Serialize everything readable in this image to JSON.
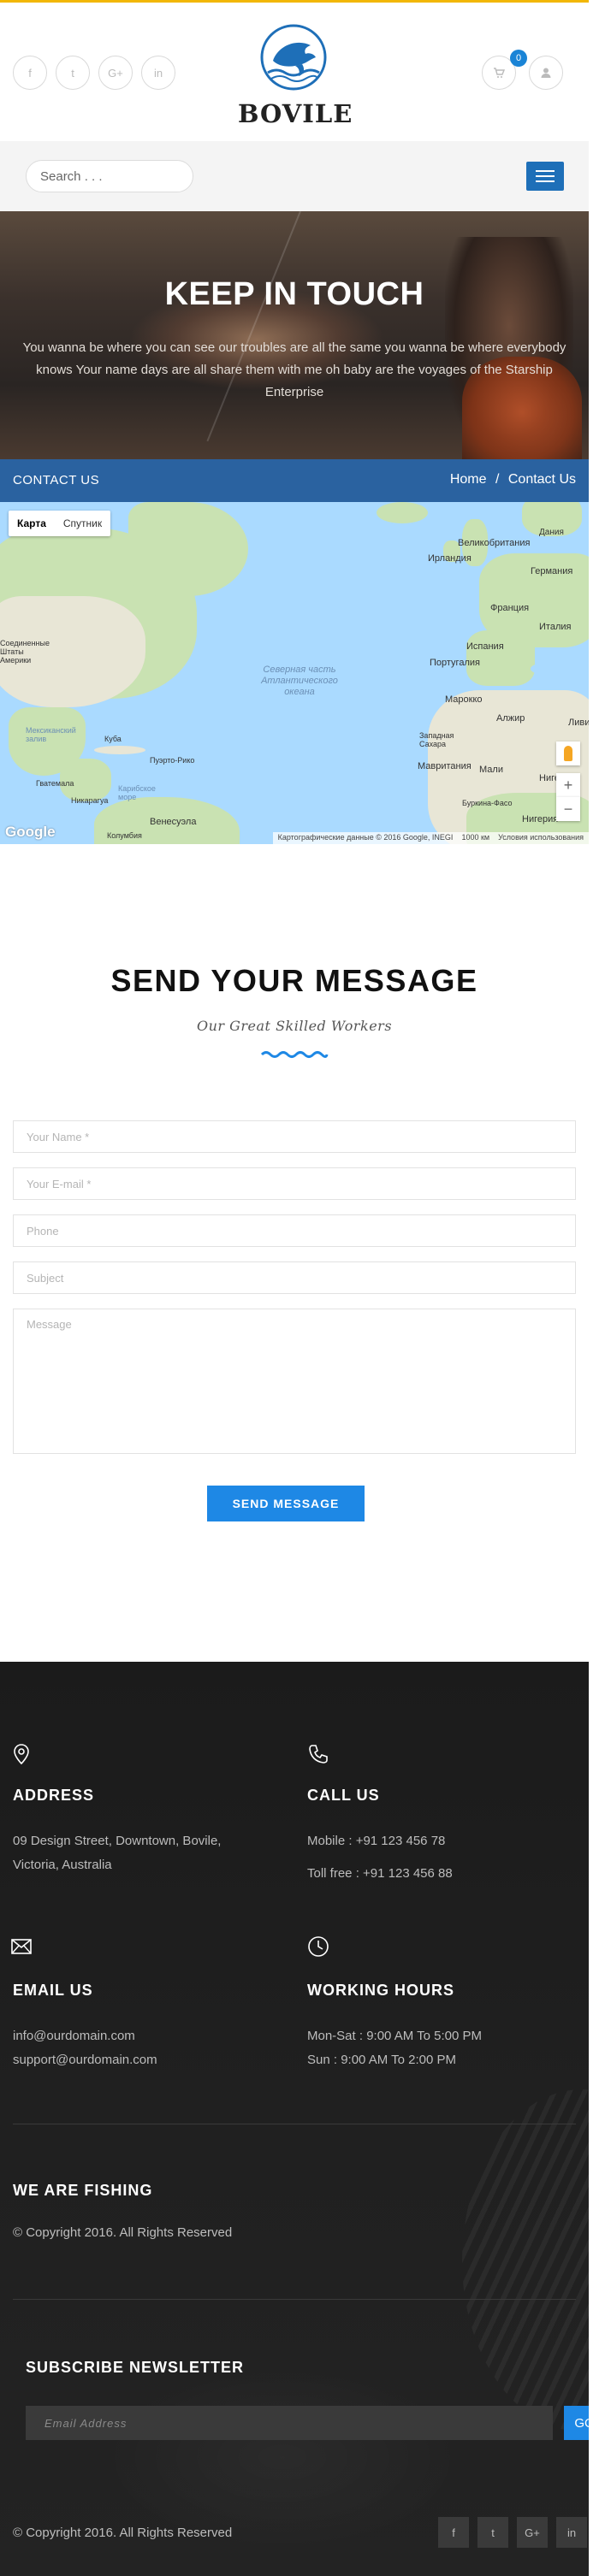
{
  "brand": {
    "name": "BOVILE",
    "accent": "#1e88e5",
    "topline_color": "#f2b705"
  },
  "header": {
    "social": [
      {
        "icon": "facebook-icon",
        "glyph": "f"
      },
      {
        "icon": "twitter-icon",
        "glyph": "t"
      },
      {
        "icon": "google-plus-icon",
        "glyph": "G+"
      },
      {
        "icon": "linkedin-icon",
        "glyph": "in"
      }
    ],
    "cart_count": "0"
  },
  "search": {
    "placeholder": "Search . . ."
  },
  "hero": {
    "title": "KEEP IN TOUCH",
    "text": "You wanna be where you can see our troubles are all the same you wanna be where everybody knows Your name days are all share them with me oh baby are the voyages of the Starship Enterprise"
  },
  "breadcrumb": {
    "page": "CONTACT US",
    "home": "Home",
    "sep": "/",
    "current": "Contact Us"
  },
  "map": {
    "toggle_map": "Карта",
    "toggle_satellite": "Спутник",
    "ocean_label": "Северная часть Атлантического океана",
    "labels": [
      {
        "text": "Великобритания"
      },
      {
        "text": "Ирландия"
      },
      {
        "text": "Дания"
      },
      {
        "text": "Германия"
      },
      {
        "text": "Франция"
      },
      {
        "text": "Италия"
      },
      {
        "text": "Испания"
      },
      {
        "text": "Португалия"
      },
      {
        "text": "Марокко"
      },
      {
        "text": "Алжир"
      },
      {
        "text": "Ливия"
      },
      {
        "text": "Западная Сахара"
      },
      {
        "text": "Мавритания"
      },
      {
        "text": "Мали"
      },
      {
        "text": "Нигер"
      },
      {
        "text": "Нигерия"
      },
      {
        "text": "Буркина-Фасо"
      },
      {
        "text": "Куба"
      },
      {
        "text": "Пуэрто-Рико"
      },
      {
        "text": "Гватемала"
      },
      {
        "text": "Никарагуа"
      },
      {
        "text": "Венесуэла"
      },
      {
        "text": "Колумбия"
      },
      {
        "text": "Мексиканский залив"
      },
      {
        "text": "Карибское море"
      },
      {
        "text": "Соединенные Штаты Америки"
      }
    ],
    "zoom_in": "+",
    "zoom_out": "−",
    "google": "Google",
    "attribution": "Картографические данные © 2016 Google, INEGI",
    "scale": "1000 км",
    "terms": "Условия использования"
  },
  "message": {
    "title": "SEND YOUR MESSAGE",
    "subtitle": "Our Great Skilled Workers",
    "name_placeholder": "Your Name *",
    "email_placeholder": "Your E-mail *",
    "phone_placeholder": "Phone",
    "subject_placeholder": "Subject",
    "message_placeholder": "Message",
    "send_label": "SEND MESSAGE"
  },
  "footer": {
    "address": {
      "title": "ADDRESS",
      "line1": "09 Design Street, Downtown, Bovile,",
      "line2": "Victoria, Australia"
    },
    "call": {
      "title": "CALL US",
      "mobile": "Mobile : +91 123 456 78",
      "tollfree": "Toll free : +91 123 456 88"
    },
    "email": {
      "title": "EMAIL US",
      "line1": "info@ourdomain.com",
      "line2": "support@ourdomain.com"
    },
    "hours": {
      "title": "WORKING HOURS",
      "line1": "Mon-Sat : 9:00 AM To 5:00 PM",
      "line2": "Sun : 9:00 AM To 2:00 PM"
    },
    "about_title": "WE ARE FISHING",
    "about_copyright": "© Copyright 2016. All Rights Reserved",
    "newsletter_title": "SUBSCRIBE NEWSLETTER",
    "newsletter_placeholder": "Email Address",
    "go_label": "GO",
    "bottom_copyright": "© Copyright 2016. All Rights Reserved",
    "social": [
      {
        "icon": "facebook-icon",
        "glyph": "f"
      },
      {
        "icon": "twitter-icon",
        "glyph": "t"
      },
      {
        "icon": "google-plus-icon",
        "glyph": "G+"
      },
      {
        "icon": "linkedin-icon",
        "glyph": "in"
      }
    ]
  }
}
